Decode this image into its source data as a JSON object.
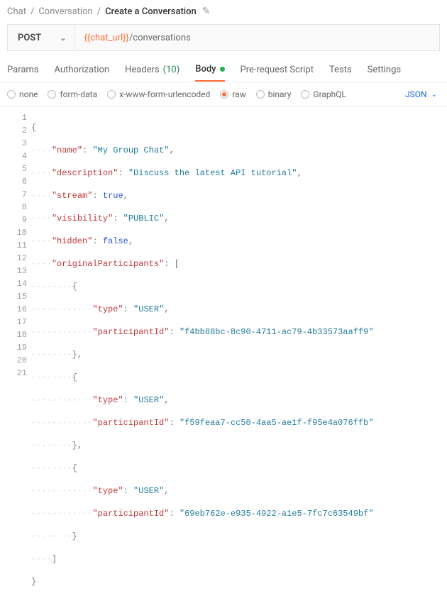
{
  "breadcrumb": {
    "items": [
      "Chat",
      "Conversation",
      "Create a Conversation"
    ]
  },
  "request": {
    "method": "POST",
    "url_var": "{{chat_url}}",
    "url_suffix": "/conversations"
  },
  "tabs": {
    "params": "Params",
    "auth": "Authorization",
    "headers": "Headers",
    "headers_count": "(10)",
    "body": "Body",
    "prereq": "Pre-request Script",
    "tests": "Tests",
    "settings": "Settings"
  },
  "body_types": {
    "none": "none",
    "form": "form-data",
    "urlenc": "x-www-form-urlencoded",
    "raw": "raw",
    "binary": "binary",
    "graphql": "GraphQL",
    "format": "JSON"
  },
  "json_body": {
    "keys": {
      "name": "name",
      "description": "description",
      "stream": "stream",
      "visibility": "visibility",
      "hidden": "hidden",
      "participants": "originalParticipants",
      "type": "type",
      "pid": "participantId"
    },
    "values": {
      "name": "My Group Chat",
      "description": "Discuss the latest API tutorial",
      "stream": "true",
      "visibility": "PUBLIC",
      "hidden": "false",
      "type": "USER",
      "pid1": "f4bb88bc-8c90-4711-ac79-4b33573aaff9",
      "pid2": "f59feaa7-cc50-4aa5-ae1f-f95e4a076ffb",
      "pid3": "69eb762e-e935-4922-a1e5-7fc7c63549bf"
    }
  },
  "chart_data": null
}
